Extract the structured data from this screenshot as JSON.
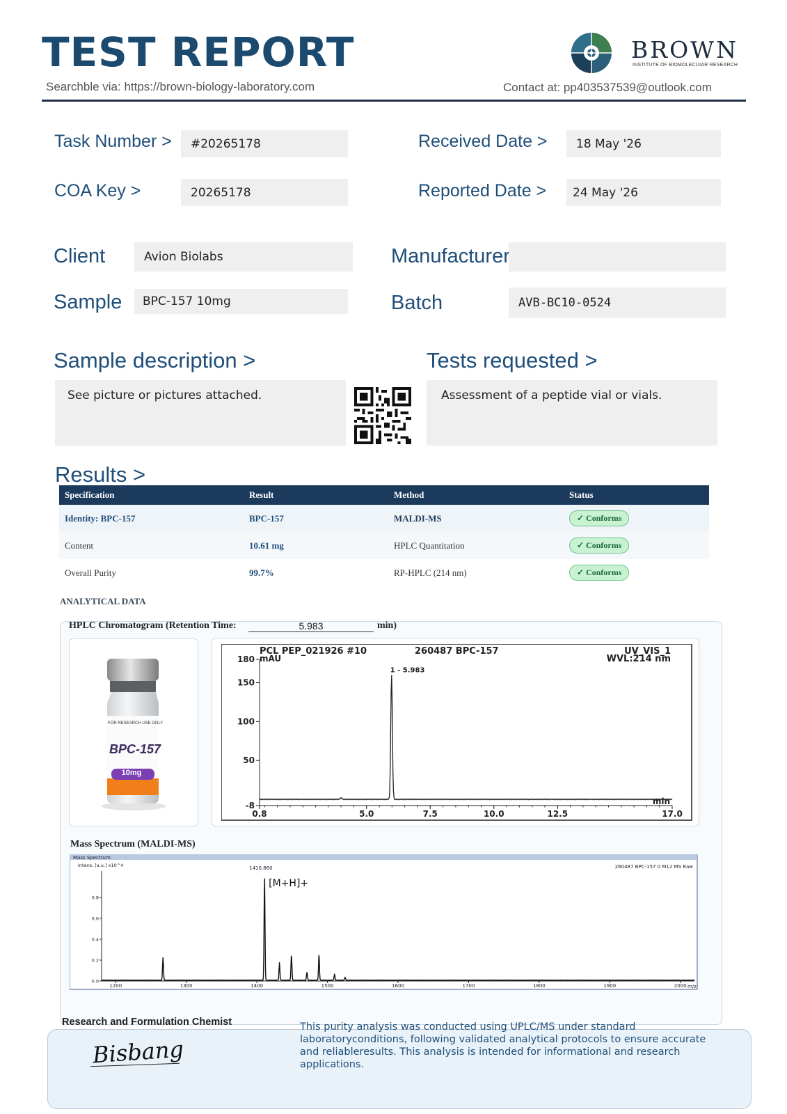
{
  "header": {
    "title": "TEST REPORT",
    "search_note": "Searchble via: https://brown-biology-laboratory.com",
    "contact": "Contact at: pp403537539@outlook.com",
    "brand_name": "BROWN",
    "brand_sub": "INSTITUTE OF BIOMOLECUIAR RESEARCH"
  },
  "fields": {
    "task_number_label": "Task Number  >",
    "task_number": "#20265178",
    "coa_key_label": "COA  Key >",
    "coa_key": "20265178",
    "received_label": "Received Date  >",
    "received": "18 May '26",
    "reported_label": "Reported Date >",
    "reported": "24 May '26",
    "client_label": "Client",
    "client": "Avion Biolabs",
    "sample_label": "Sample",
    "sample": "BPC-157 10mg",
    "manufacturer_label": "Manufacturer",
    "manufacturer": "",
    "batch_label": "Batch",
    "batch": "AVB-BC10-0524"
  },
  "description": {
    "sample_desc_label": "Sample description  >",
    "sample_desc": "See picture or pictures attached.",
    "tests_label": "Tests requested  >",
    "tests": "Assessment of a peptide vial or vials."
  },
  "results": {
    "label": "Results  >",
    "headers": [
      "Specification",
      "Result",
      "Method",
      "Status"
    ],
    "rows": [
      {
        "spec": "Identity:  BPC-157",
        "result": "BPC-157",
        "method": "MALDI-MS",
        "status": "✓ Conforms"
      },
      {
        "spec": "Content",
        "result": "10.61   mg",
        "method": "HPLC Quantitation",
        "status": "✓ Conforms"
      },
      {
        "spec": "Overall Purity",
        "result": "99.7%",
        "method": "RP-HPLC (214 nm)",
        "status": "✓ Conforms"
      }
    ]
  },
  "analytical": {
    "label": "ANALYTICAL DATA",
    "hplc_title_prefix": "HPLC Chromatogram (Retention Time:",
    "retention_time": "5.983",
    "hplc_title_suffix": "min)",
    "vial": {
      "line1": "FOR RESEARCH USE ONLY",
      "name": "BPC-157",
      "dose": "10mg"
    },
    "maldi_title": "Mass Spectrum (MALDI-MS)"
  },
  "chart_data": [
    {
      "type": "line",
      "header_left": "PCL PEP_021926 #10",
      "header_mid": "260487 BPC-157",
      "header_right_1": "UV_VIS_1",
      "header_right_2": "WVL:214 nm",
      "ylabel": "mAU",
      "xlabel": "min",
      "peak_label": "1 - 5.983",
      "ylim": [
        -8,
        180
      ],
      "xlim": [
        0.8,
        17.0
      ],
      "y_ticks": [
        -8,
        50,
        100,
        150,
        180
      ],
      "x_ticks": [
        0.8,
        5.0,
        7.5,
        10.0,
        12.5,
        17.0
      ],
      "peaks": [
        {
          "x": 4.0,
          "y": 2
        },
        {
          "x": 5.983,
          "y": 160
        }
      ],
      "baseline": 0
    },
    {
      "type": "line",
      "panel_title": "Mass Spectrum",
      "ylabel": "Intens. [a.u.] x10^4",
      "xlabel": "m/z",
      "header_right": "260487 BPC-157 0 M12 MS Raw",
      "peak_label": "1410.860",
      "annotation": "[M+H]+",
      "xlim": [
        1180,
        2020
      ],
      "ylim": [
        0,
        1.0
      ],
      "x_ticks": [
        1200,
        1300,
        1400,
        1500,
        1600,
        1700,
        1800,
        1900,
        2000
      ],
      "y_ticks": [
        0.0,
        0.2,
        0.4,
        0.6,
        0.8
      ],
      "peaks": [
        {
          "x": 1267,
          "y": 0.22
        },
        {
          "x": 1410.86,
          "y": 1.0
        },
        {
          "x": 1432,
          "y": 0.17
        },
        {
          "x": 1449,
          "y": 0.25
        },
        {
          "x": 1471,
          "y": 0.08
        },
        {
          "x": 1488,
          "y": 0.25
        },
        {
          "x": 1510,
          "y": 0.06
        },
        {
          "x": 1525,
          "y": 0.03
        }
      ]
    }
  ],
  "footer": {
    "role": "Research and Formulation Chemist",
    "signature": "Bisbang",
    "note": "This purity analysis was conducted using UPLC/MS under standard laboratoryconditions, following validated analytical protocols to ensure accurate and reliableresults. This analysis is intended for informational and research applications."
  }
}
